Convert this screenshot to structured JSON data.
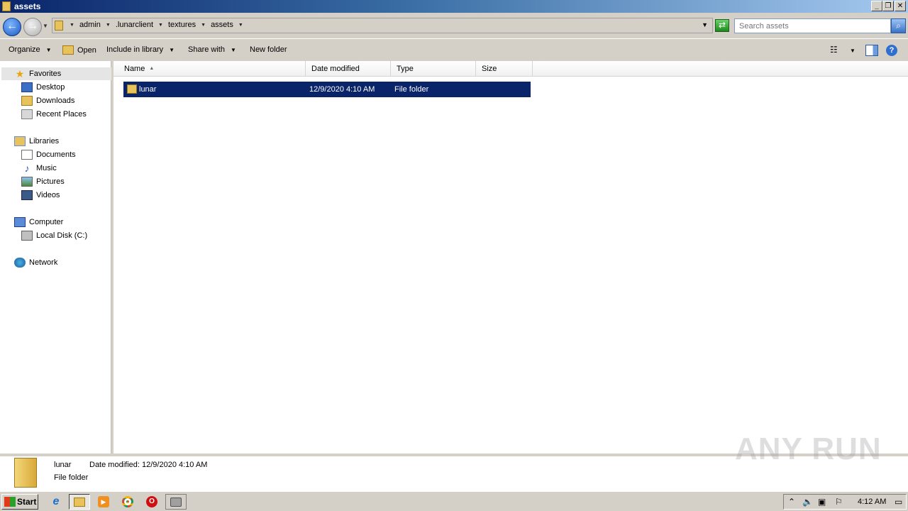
{
  "window": {
    "title": "assets"
  },
  "address": {
    "breadcrumbs": [
      "admin",
      ".lunarclient",
      "textures",
      "assets"
    ]
  },
  "search": {
    "placeholder": "Search assets"
  },
  "toolbar": {
    "organize": "Organize",
    "open": "Open",
    "include_in_library": "Include in library",
    "share_with": "Share with",
    "new_folder": "New folder"
  },
  "nav": {
    "favorites": "Favorites",
    "desktop": "Desktop",
    "downloads": "Downloads",
    "recent_places": "Recent Places",
    "libraries": "Libraries",
    "documents": "Documents",
    "music": "Music",
    "pictures": "Pictures",
    "videos": "Videos",
    "computer": "Computer",
    "local_disk": "Local Disk (C:)",
    "network": "Network"
  },
  "columns": {
    "name": "Name",
    "date_modified": "Date modified",
    "type": "Type",
    "size": "Size"
  },
  "files": [
    {
      "name": "lunar",
      "date_modified": "12/9/2020 4:10 AM",
      "type": "File folder",
      "size": ""
    }
  ],
  "details": {
    "name": "lunar",
    "date_label": "Date modified:",
    "date_value": "12/9/2020 4:10 AM",
    "type": "File folder"
  },
  "watermark": "ANY RUN",
  "taskbar": {
    "start": "Start",
    "clock": "4:12 AM"
  },
  "colors": {
    "selection": "#0a246a",
    "titlebar": "#0a246a",
    "chrome": "#d4d0c8"
  }
}
